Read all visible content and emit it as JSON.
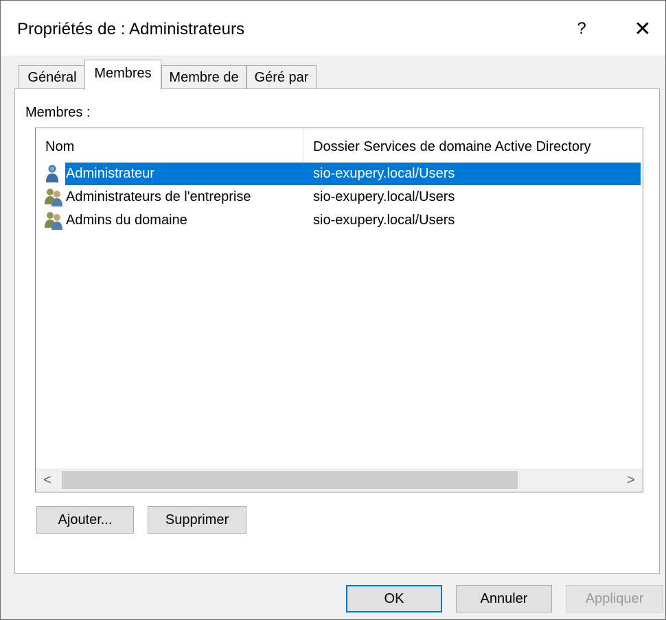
{
  "window": {
    "title": "Propriétés de : Administrateurs",
    "help_label": "?",
    "close_label": "✕"
  },
  "tabs": [
    {
      "label": "Général",
      "active": false
    },
    {
      "label": "Membres",
      "active": true
    },
    {
      "label": "Membre de",
      "active": false
    },
    {
      "label": "Géré par",
      "active": false
    }
  ],
  "members": {
    "label": "Membres :",
    "columns": [
      "Nom",
      "Dossier Services de domaine Active Directory"
    ],
    "rows": [
      {
        "name": "Administrateur",
        "folder": "sio-exupery.local/Users",
        "icon": "user-icon",
        "selected": true
      },
      {
        "name": "Administrateurs de l'entreprise",
        "folder": "sio-exupery.local/Users",
        "icon": "group-icon",
        "selected": false
      },
      {
        "name": "Admins du domaine",
        "folder": "sio-exupery.local/Users",
        "icon": "group-icon",
        "selected": false
      }
    ],
    "scroll_left": "<",
    "scroll_right": ">"
  },
  "actions": {
    "add_label": "Ajouter...",
    "remove_label": "Supprimer"
  },
  "footer": {
    "ok_label": "OK",
    "cancel_label": "Annuler",
    "apply_label": "Appliquer"
  },
  "colors": {
    "selection": "#0078d7",
    "dialog_bg": "#f0f0f0",
    "default_button_border": "#0078d7"
  }
}
